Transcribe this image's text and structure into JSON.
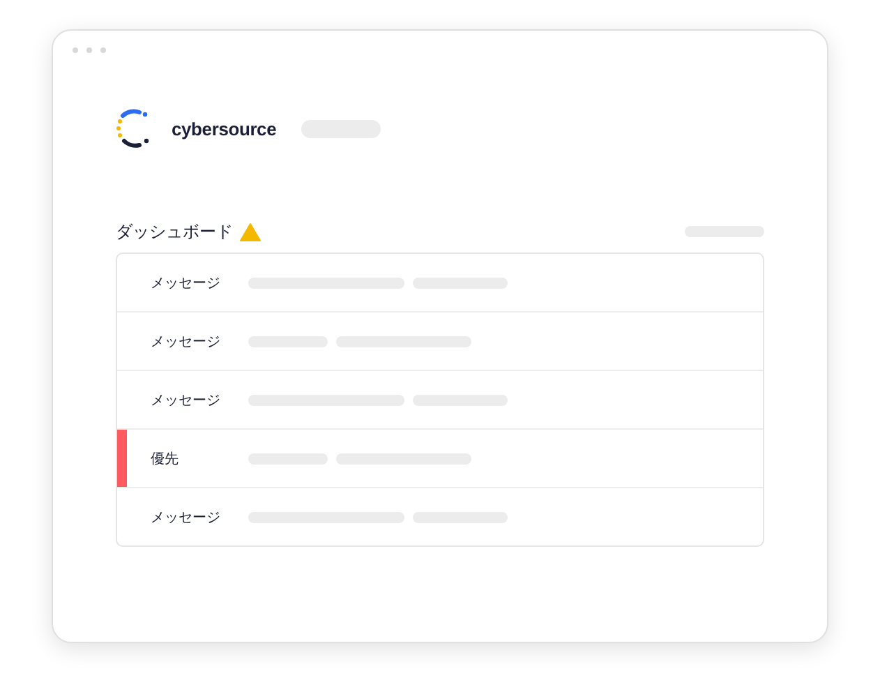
{
  "brand": {
    "name": "cybersource"
  },
  "dashboard": {
    "title": "ダッシュボード"
  },
  "rows": [
    {
      "label": "メッセージ",
      "flagged": false,
      "kind": "long-first"
    },
    {
      "label": "メッセージ",
      "flagged": false,
      "kind": "short-first"
    },
    {
      "label": "メッセージ",
      "flagged": false,
      "kind": "long-first"
    },
    {
      "label": "優先",
      "flagged": true,
      "kind": "short-first"
    },
    {
      "label": "メッセージ",
      "flagged": false,
      "kind": "long-first"
    }
  ]
}
